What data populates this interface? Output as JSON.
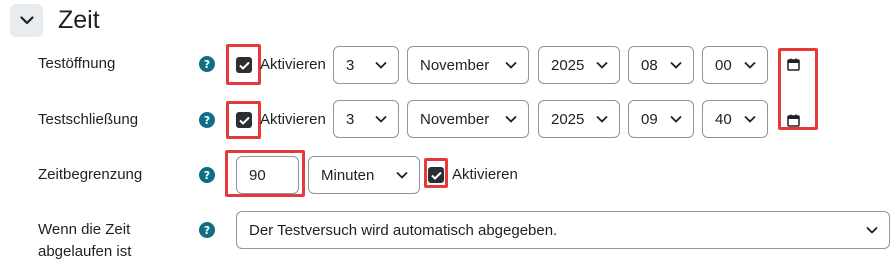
{
  "section": {
    "title": "Zeit"
  },
  "icons": {
    "help": "help-icon",
    "collapse": "chevron-down-icon",
    "calendar": "calendar-icon",
    "check": "check-icon"
  },
  "colors": {
    "help": "#0f6e84",
    "highlight": "#e53a3a",
    "checkbox": "#2b2f33"
  },
  "open": {
    "label": "Testöffnung",
    "enable_label": "Aktivieren",
    "enabled": true,
    "day": "3",
    "month": "November",
    "year": "2025",
    "hour": "08",
    "minute": "00"
  },
  "close": {
    "label": "Testschließung",
    "enable_label": "Aktivieren",
    "enabled": true,
    "day": "3",
    "month": "November",
    "year": "2025",
    "hour": "09",
    "minute": "40"
  },
  "timelimit": {
    "label": "Zeitbegrenzung",
    "value": "90",
    "unit": "Minuten",
    "enable_label": "Aktivieren",
    "enabled": true
  },
  "overdue": {
    "label_line1": "Wenn die Zeit",
    "label_line2": "abgelaufen ist",
    "value": "Der Testversuch wird automatisch abgegeben."
  }
}
